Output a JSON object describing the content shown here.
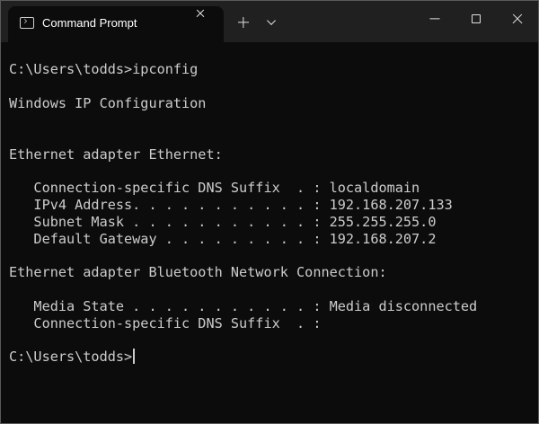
{
  "window": {
    "tab_title": "Command Prompt"
  },
  "icons": {
    "tab": "console-icon",
    "tab_close": "close-icon",
    "new_tab": "plus-icon",
    "dropdown": "chevron-down-icon",
    "minimize": "minimize-icon",
    "maximize": "maximize-icon",
    "close": "close-icon"
  },
  "colors": {
    "background": "#0c0c0c",
    "titlebar": "#202020",
    "text": "#cccccc"
  },
  "console": {
    "lines": [
      "C:\\Users\\todds>ipconfig",
      "Windows IP Configuration",
      "Ethernet adapter Ethernet:",
      "   Connection-specific DNS Suffix  . : localdomain",
      "   IPv4 Address. . . . . . . . . . . : 192.168.207.133",
      "   Subnet Mask . . . . . . . . . . . : 255.255.255.0",
      "   Default Gateway . . . . . . . . . : 192.168.207.2",
      "Ethernet adapter Bluetooth Network Connection:",
      "   Media State . . . . . . . . . . . : Media disconnected",
      "   Connection-specific DNS Suffix  . :",
      "C:\\Users\\todds>"
    ]
  }
}
